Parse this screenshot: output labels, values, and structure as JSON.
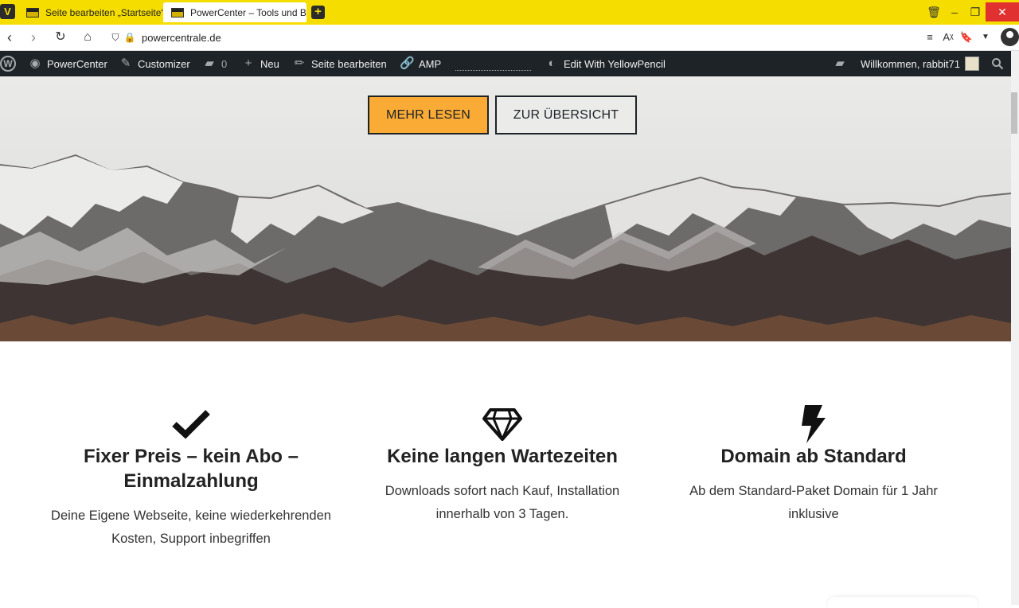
{
  "browser": {
    "tabs": [
      {
        "title": "Seite bearbeiten „Startseite“"
      },
      {
        "title": "PowerCenter – Tools und Bu"
      }
    ],
    "url": "powercentrale.de"
  },
  "adminbar": {
    "site_name": "PowerCenter",
    "customizer": "Customizer",
    "comments_count": "0",
    "new_label": "Neu",
    "edit_page": "Seite bearbeiten",
    "amp": "AMP",
    "yellowpencil": "Edit With YellowPencil",
    "greeting": "Willkommen, rabbit71"
  },
  "hero": {
    "primary_button": "MEHR LESEN",
    "secondary_button": "ZUR ÜBERSICHT"
  },
  "features": [
    {
      "icon": "checkmark-icon",
      "title": "Fixer Preis – kein Abo – Einmalzahlung",
      "text": "Deine Eigene Webseite, keine wiederkehrenden Kosten, Support inbegriffen"
    },
    {
      "icon": "diamond-icon",
      "title": "Keine langen Wartezeiten",
      "text": "Downloads sofort nach Kauf, Installation innerhalb von 3 Tagen."
    },
    {
      "icon": "lightning-icon",
      "title": "Domain ab Standard",
      "text": "Ab dem Standard-Paket Domain für 1 Jahr inklusive"
    }
  ],
  "colors": {
    "browser_chrome": "#f5dd00",
    "admin_bar": "#1d2327",
    "primary_button": "#f9ab35",
    "window_close": "#e03030"
  }
}
